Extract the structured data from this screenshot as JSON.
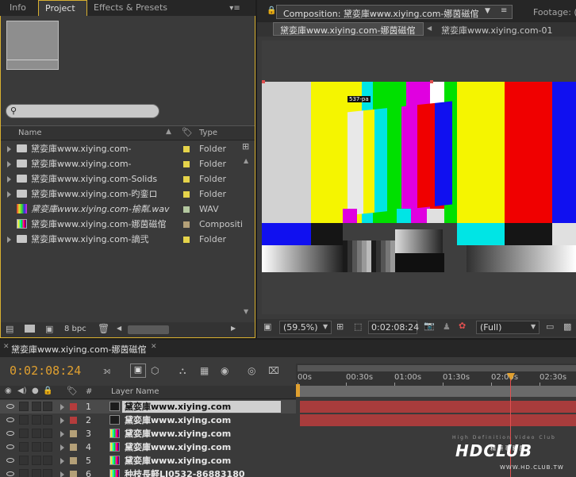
{
  "project_panel": {
    "tabs": [
      {
        "label": "Info"
      },
      {
        "label": "Project"
      },
      {
        "label": "Effects & Presets"
      }
    ],
    "search_placeholder": "",
    "columns": {
      "name": "Name",
      "type": "Type"
    },
    "items": [
      {
        "name": "黛娈庫www.xiying.com-",
        "type": "Folder",
        "swatch": "#e6d44a",
        "kind": "folder",
        "italic": false
      },
      {
        "name": "黛娈庫www.xiying.com-",
        "type": "Folder",
        "swatch": "#e6d44a",
        "kind": "folder",
        "italic": false
      },
      {
        "name": "黛娈庫www.xiying.com-Solids",
        "type": "Folder",
        "swatch": "#e6d44a",
        "kind": "folder",
        "italic": false
      },
      {
        "name": "黛娈庫www.xiying.com-旳銮ロ",
        "type": "Folder",
        "swatch": "#e6d44a",
        "kind": "folder",
        "italic": false
      },
      {
        "name": "黛娈庫www.xiying.com-揄粼.wav",
        "type": "WAV",
        "swatch": "#b4c8a0",
        "kind": "wav",
        "italic": true
      },
      {
        "name": "黛娈庫www.xiying.com-娜茵磁倌",
        "type": "Compositio",
        "swatch": "#b4a078",
        "kind": "comp",
        "italic": false
      },
      {
        "name": "黛娈庫www.xiying.com-謫弐",
        "type": "Folder",
        "swatch": "#e6d44a",
        "kind": "folder",
        "italic": false
      }
    ],
    "bpc": "8 bpc"
  },
  "comp_panel": {
    "tab_label": "Composition: 黛娈庫www.xiying.com-娜茵磁倌",
    "footage_label": "Footage: (",
    "breadcrumb_active": "黛娈庫www.xiying.com-娜茵磁倌",
    "breadcrumb_next": "黛娈庫www.xiying.com-01",
    "footage_label_tag": "537-pa",
    "zoom": "(59.5%)",
    "timecode": "0:02:08:24",
    "resolution": "(Full)"
  },
  "timeline": {
    "tab_label": "黛娈庫www.xiying.com-娜茵磁倌",
    "current_time": "0:02:08:24",
    "column_hash": "#",
    "column_layer": "Layer Name",
    "ruler_labels": [
      "00s",
      "00:30s",
      "01:00s",
      "01:30s",
      "02:00s",
      "02:30s"
    ],
    "layers": [
      {
        "num": "1",
        "name": "黛娈庫www.xiying.com",
        "label_color": "#b43c3c",
        "thumb": "solid",
        "selected": true
      },
      {
        "num": "2",
        "name": "黛娈庫www.xiying.com",
        "label_color": "#b43c3c",
        "thumb": "solid",
        "selected": false
      },
      {
        "num": "3",
        "name": "黛娈庫www.xiying.com",
        "label_color": "#b4a078",
        "thumb": "comp",
        "selected": false
      },
      {
        "num": "4",
        "name": "黛娈庫www.xiying.com",
        "label_color": "#b4a078",
        "thumb": "comp",
        "selected": false
      },
      {
        "num": "5",
        "name": "黛娈庫www.xiying.com",
        "label_color": "#b4a078",
        "thumb": "comp",
        "selected": false
      },
      {
        "num": "6",
        "name": "种枝長軽LI0532-86883180",
        "label_color": "#b4a078",
        "thumb": "comp",
        "selected": false
      }
    ]
  },
  "watermark": {
    "tagline": "High Definition Video Club",
    "logo": "HDCLUB",
    "cn": "精 研 事 務 所",
    "url": "WWW.HD.CLUB.TW"
  },
  "colors": {
    "accent": "#d8b030",
    "timecode": "#e0a030",
    "playhead": "#e05050",
    "layer_bar": "#a83c3c"
  }
}
